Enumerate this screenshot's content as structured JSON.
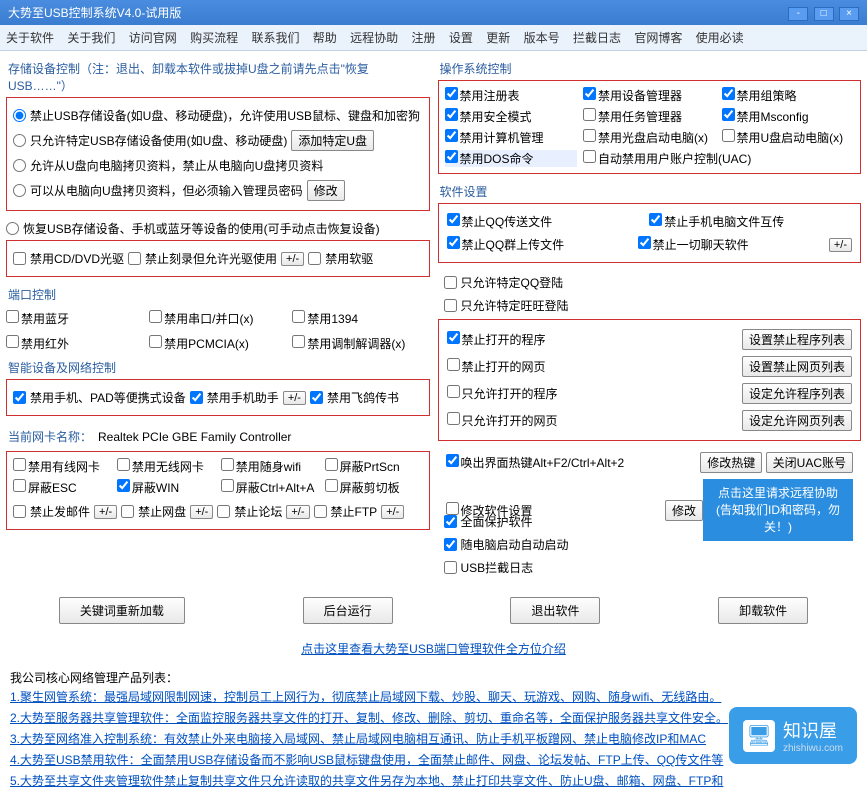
{
  "title": "大势至USB控制系统V4.0-试用版",
  "menu": [
    "关于软件",
    "关于我们",
    "访问官网",
    "购买流程",
    "联系我们",
    "帮助",
    "远程协助",
    "注册",
    "设置",
    "更新",
    "版本号",
    "拦截日志",
    "官网博客",
    "使用必读"
  ],
  "storage": {
    "label": "存储设备控制（注：退出、卸载本软件或拔掉U盘之前请先点击\"恢复USB……\"）",
    "r1": "禁止USB存储设备(如U盘、移动硬盘)，允许使用USB鼠标、键盘和加密狗",
    "r2": "只允许特定USB存储设备使用(如U盘、移动硬盘)",
    "r2btn": "添加特定U盘",
    "r3": "允许从U盘向电脑拷贝资料，禁止从电脑向U盘拷贝资料",
    "r4": "可以从电脑向U盘拷贝资料，但必须输入管理员密码",
    "r4btn": "修改",
    "r5": "恢复USB存储设备、手机或蓝牙等设备的使用(可手动点击恢复设备)",
    "c1": "禁用CD/DVD光驱",
    "c2": "禁止刻录但允许光驱使用",
    "c3": "禁用软驱"
  },
  "port": {
    "label": "端口控制",
    "c1": "禁用蓝牙",
    "c2": "禁用串口/并口(x)",
    "c3": "禁用1394",
    "c4": "禁用红外",
    "c5": "禁用PCMCIA(x)",
    "c6": "禁用调制解调器(x)"
  },
  "smart": {
    "label": "智能设备及网络控制",
    "c1": "禁用手机、PAD等便携式设备",
    "c2": "禁用手机助手",
    "c3": "禁用飞鸽传书"
  },
  "nic": {
    "label": "当前网卡名称：",
    "name": "Realtek PCIe GBE Family Controller",
    "c1": "禁用有线网卡",
    "c2": "禁用无线网卡",
    "c3": "禁用随身wifi",
    "c4": "屏蔽PrtScn",
    "c5": "屏蔽ESC",
    "c6": "屏蔽WIN",
    "c7": "屏蔽Ctrl+Alt+A",
    "c8": "屏蔽剪切板",
    "c9": "禁止发邮件",
    "c10": "禁止网盘",
    "c11": "禁止论坛",
    "c12": "禁止FTP"
  },
  "os": {
    "label": "操作系统控制",
    "c1": "禁用注册表",
    "c2": "禁用设备管理器",
    "c3": "禁用组策略",
    "c4": "禁用安全模式",
    "c5": "禁用任务管理器",
    "c6": "禁用Msconfig",
    "c7": "禁用计算机管理",
    "c8": "禁用光盘启动电脑(x)",
    "c9": "禁用U盘启动电脑(x)",
    "c10": "禁用DOS命令",
    "c11": "自动禁用用户账户控制(UAC)"
  },
  "sw": {
    "label": "软件设置",
    "c1": "禁止QQ传送文件",
    "c2": "禁止手机电脑文件互传",
    "c3": "禁止QQ群上传文件",
    "c4": "禁止一切聊天软件",
    "c5": "只允许特定QQ登陆",
    "c6": "只允许特定旺旺登陆",
    "p1": "禁止打开的程序",
    "b1": "设置禁止程序列表",
    "p2": "禁止打开的网页",
    "b2": "设置禁止网页列表",
    "p3": "只允许打开的程序",
    "b3": "设定允许程序列表",
    "p4": "只允许打开的网页",
    "b4": "设定允许网页列表",
    "h1": "唤出界面热键Alt+F2/Ctrl+Alt+2",
    "hb1": "修改热键",
    "hb2": "关闭UAC账号",
    "h2": "修改软件设置",
    "hb3": "修改",
    "h3": "全面保护软件",
    "h4": "随电脑启动自动启动",
    "h5": "USB拦截日志",
    "banner1": "点击这里请求远程协助",
    "banner2": "(告知我们ID和密码，勿关！)"
  },
  "footer": {
    "b1": "关键词重新加载",
    "b2": "后台运行",
    "b3": "退出软件",
    "b4": "卸载软件"
  },
  "links": {
    "center": "点击这里查看大势至USB端口管理软件全方位介绍",
    "label": "我公司核心网络管理产品列表：",
    "l1": "1.聚生网管系统：最强局域网限制网速，控制员工上网行为，彻底禁止局域网下载、炒股、聊天、玩游戏、网购、随身wifi、无线路由。",
    "l2": "2.大势至服务器共享管理软件：全面监控服务器共享文件的打开、复制、修改、删除、剪切、重命名等，全面保护服务器共享文件安全。",
    "l3": "3.大势至网络准入控制系统：有效禁止外来电脑接入局域网、禁止局域网电脑相互通讯、防止手机平板蹭网、禁止电脑修改IP和MAC",
    "l4": "4.大势至USB禁用软件：全面禁用USB存储设备而不影响USB鼠标键盘使用，全面禁止邮件、网盘、论坛发帖、FTP上传、QQ传文件等",
    "l5": "5.大势至共享文件夹管理软件禁止复制共享文件只允许读取的共享文件另存为本地、禁止打印共享文件、防止U盘、邮箱、网盘、FTP和"
  },
  "pm": "+/-",
  "logo": {
    "name": "知识屋",
    "url": "zhishiwu.com"
  }
}
